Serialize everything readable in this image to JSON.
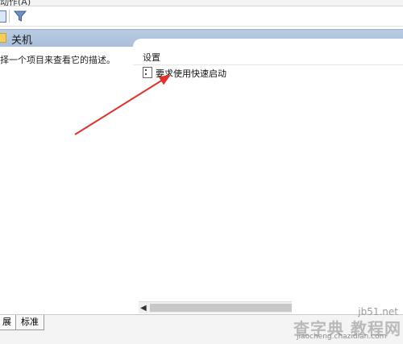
{
  "menubar": {
    "partial_text": "动作(A)"
  },
  "toolbar": {
    "filter_icon": "filter-icon"
  },
  "header": {
    "title": "关机",
    "folder_icon": "folder-icon"
  },
  "left_pane": {
    "description": "择一个项目来查看它的描述。"
  },
  "right_pane": {
    "column_header": "设置",
    "settings": [
      {
        "label": "要求使用快速启动",
        "icon": "setting-policy-icon"
      }
    ]
  },
  "tabs": [
    {
      "label": "展"
    },
    {
      "label": "标准"
    }
  ],
  "watermark": {
    "top": "jb51.net",
    "main": "查字典 教程网",
    "sub": "jiaocheng.chazidian.com"
  },
  "annotation": {
    "arrow_color": "#e0312b"
  }
}
